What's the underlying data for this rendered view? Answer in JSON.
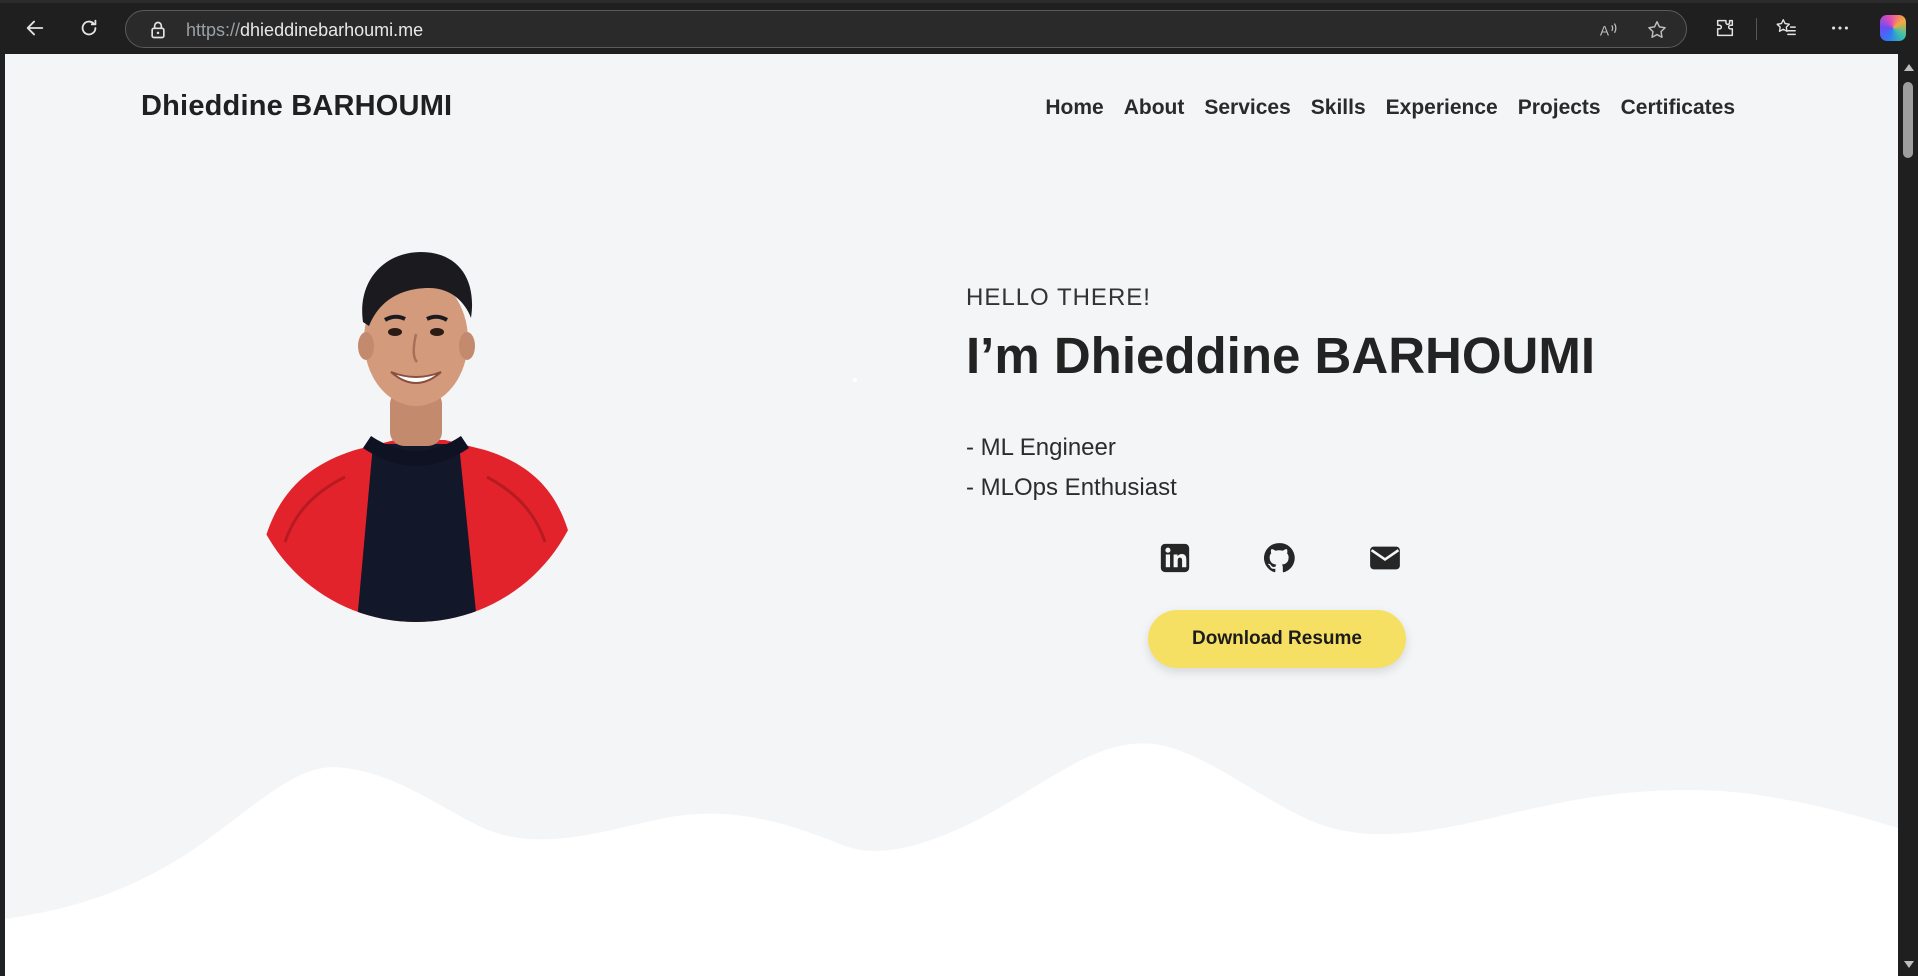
{
  "browser": {
    "url_protocol": "https://",
    "url_host": "dhieddinebarhoumi.me"
  },
  "site": {
    "logo": "Dhieddine BARHOUMI",
    "nav": [
      "Home",
      "About",
      "Services",
      "Skills",
      "Experience",
      "Projects",
      "Certificates"
    ]
  },
  "hero": {
    "greeting": "HELLO THERE!",
    "name": "I’m Dhieddine BARHOUMI",
    "roles": [
      "- ML Engineer",
      "- MLOps Enthusiast"
    ],
    "resume_button": "Download Resume",
    "social_icons": [
      "linkedin-icon",
      "github-icon",
      "email-icon"
    ]
  },
  "colors": {
    "page_bg": "#f4f5f7",
    "accent": "#f5e063",
    "text": "#232323",
    "jacket": "#e3232b"
  }
}
